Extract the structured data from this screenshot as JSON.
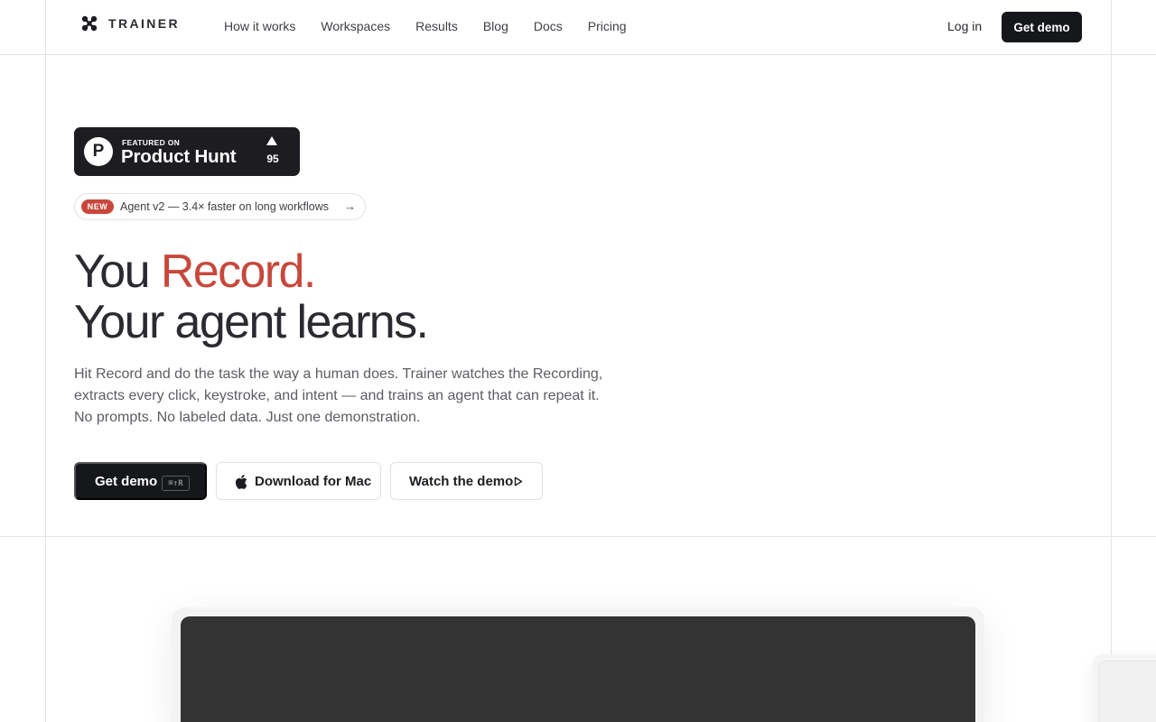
{
  "header": {
    "brand": "TRAINER",
    "nav": [
      "How it works",
      "Workspaces",
      "Results",
      "Blog",
      "Docs",
      "Pricing"
    ],
    "login_label": "Log in",
    "demo_label": "Get demo"
  },
  "product_hunt": {
    "small_text": "FEATURED ON",
    "big_text": "Product Hunt",
    "logo_letter": "P",
    "upvotes": "95"
  },
  "announcement": {
    "tag": "NEW",
    "text": "Agent v2 — 3.4× faster on long workflows",
    "arrow": "→"
  },
  "hero": {
    "line1_prefix": "You ",
    "line1_accent": "Record.",
    "line2": "Your agent learns.",
    "desc_lines": [
      "Hit Record and do the task the way a human does. Trainer watches the Recording,",
      "extracts every click, keystroke, and intent — and trains an agent that can repeat it.",
      "No prompts. No labeled data. Just one demonstration."
    ]
  },
  "cta": {
    "demo_label": "Get demo",
    "demo_shortcut": "⌘↑R",
    "mac_label": "Download for Mac",
    "watch_label": "Watch the demo"
  },
  "colors": {
    "accent": "#c8473b",
    "dark": "#16171b",
    "border": "#e4e4e7"
  }
}
